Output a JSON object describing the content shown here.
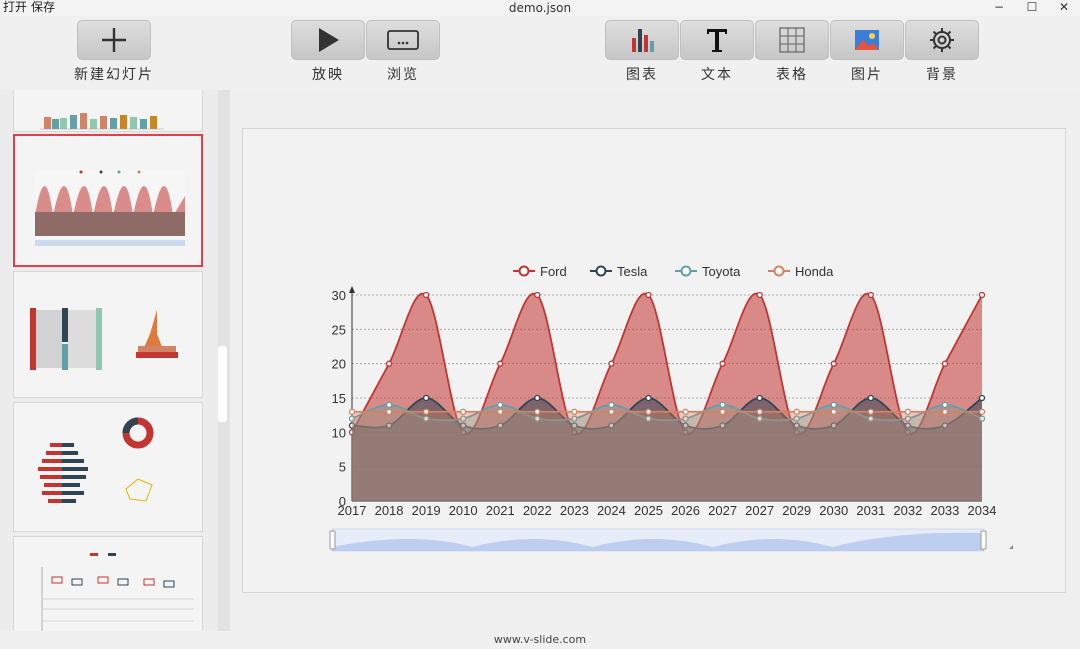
{
  "menu": {
    "open": "打开",
    "save": "保存"
  },
  "window": {
    "title": "demo.json",
    "minimize": "−",
    "maximize": "☐",
    "close": "✕"
  },
  "toolbar": {
    "new_slide": "新建幻灯片",
    "play": "放映",
    "browse": "浏览",
    "chart": "图表",
    "text": "文本",
    "table": "表格",
    "image": "图片",
    "background": "背景"
  },
  "icons": [
    "plus-icon",
    "play-icon",
    "browse-icon",
    "chart-icon",
    "text-icon",
    "table-icon",
    "image-icon",
    "gear-icon"
  ],
  "colors": {
    "ford": "#c23531",
    "tesla": "#2f4554",
    "toyota": "#61a0a8",
    "honda": "#d48265",
    "selection": "#e0404a"
  },
  "status": {
    "url": "www.v-slide.com"
  },
  "chart_data": {
    "type": "area",
    "legend": [
      "Ford",
      "Tesla",
      "Toyota",
      "Honda"
    ],
    "legend_position": "top-center",
    "categories": [
      "2017",
      "2018",
      "2019",
      "2010",
      "2021",
      "2022",
      "2023",
      "2024",
      "2025",
      "2026",
      "2027",
      "2027",
      "2029",
      "2030",
      "2031",
      "2032",
      "2033",
      "2034"
    ],
    "ylim": [
      0,
      30
    ],
    "yticks": [
      0,
      5,
      10,
      15,
      20,
      25,
      30
    ],
    "grid": true,
    "series": [
      {
        "name": "Ford",
        "values": [
          10,
          20,
          30,
          10,
          20,
          30,
          10,
          20,
          30,
          10,
          20,
          30,
          10,
          20,
          30,
          10,
          20,
          30
        ]
      },
      {
        "name": "Tesla",
        "values": [
          11,
          11,
          15,
          11,
          11,
          15,
          11,
          11,
          15,
          11,
          11,
          15,
          11,
          11,
          15,
          11,
          11,
          15
        ]
      },
      {
        "name": "Toyota",
        "values": [
          12,
          14,
          12,
          12,
          14,
          12,
          12,
          14,
          12,
          12,
          14,
          12,
          12,
          14,
          12,
          12,
          14,
          12
        ]
      },
      {
        "name": "Honda",
        "values": [
          13,
          13,
          13,
          13,
          13,
          13,
          13,
          13,
          13,
          13,
          13,
          13,
          13,
          13,
          13,
          13,
          13,
          13
        ]
      }
    ],
    "dataZoom": true
  }
}
